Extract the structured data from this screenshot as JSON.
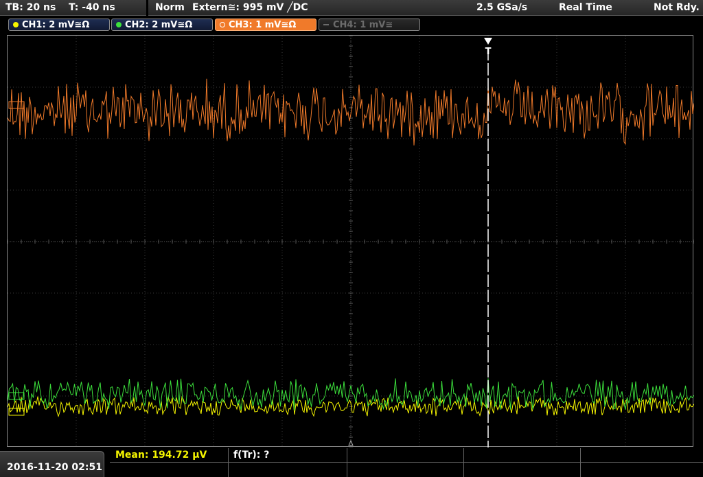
{
  "timebase": {
    "tb": "TB: 20 ns",
    "t": "T: -40 ns"
  },
  "trigger": {
    "mode": "Norm",
    "source": "Extern≅: 995 mV ╱DC",
    "sample_rate": "2.5 GSa/s",
    "acq_mode": "Real Time",
    "status": "Not Rdy."
  },
  "channels": [
    {
      "label": "CH1: 2 mV≅Ω",
      "color": "#f5f500",
      "state": "on"
    },
    {
      "label": "CH2: 2 mV≅Ω",
      "color": "#3ce03c",
      "state": "on"
    },
    {
      "label": "CH3: 1 mV≅Ω",
      "color": "#f07a2a",
      "state": "selected"
    },
    {
      "label": "CH4: 1 mV≅",
      "color": "#6b6b6b",
      "state": "off"
    }
  ],
  "markers": {
    "trigger_label": "T"
  },
  "status_bar": {
    "datetime": "2016-11-20 02:51",
    "measurements": [
      {
        "label": "Mean: 194.72 µV",
        "color": "#f5f500"
      },
      {
        "label": "f(Tr): ?",
        "color": "#ffffff"
      }
    ]
  },
  "icons": {
    "trigger_marker": "down-triangle-icon",
    "center_marker": "small-up-triangle-icon"
  }
}
